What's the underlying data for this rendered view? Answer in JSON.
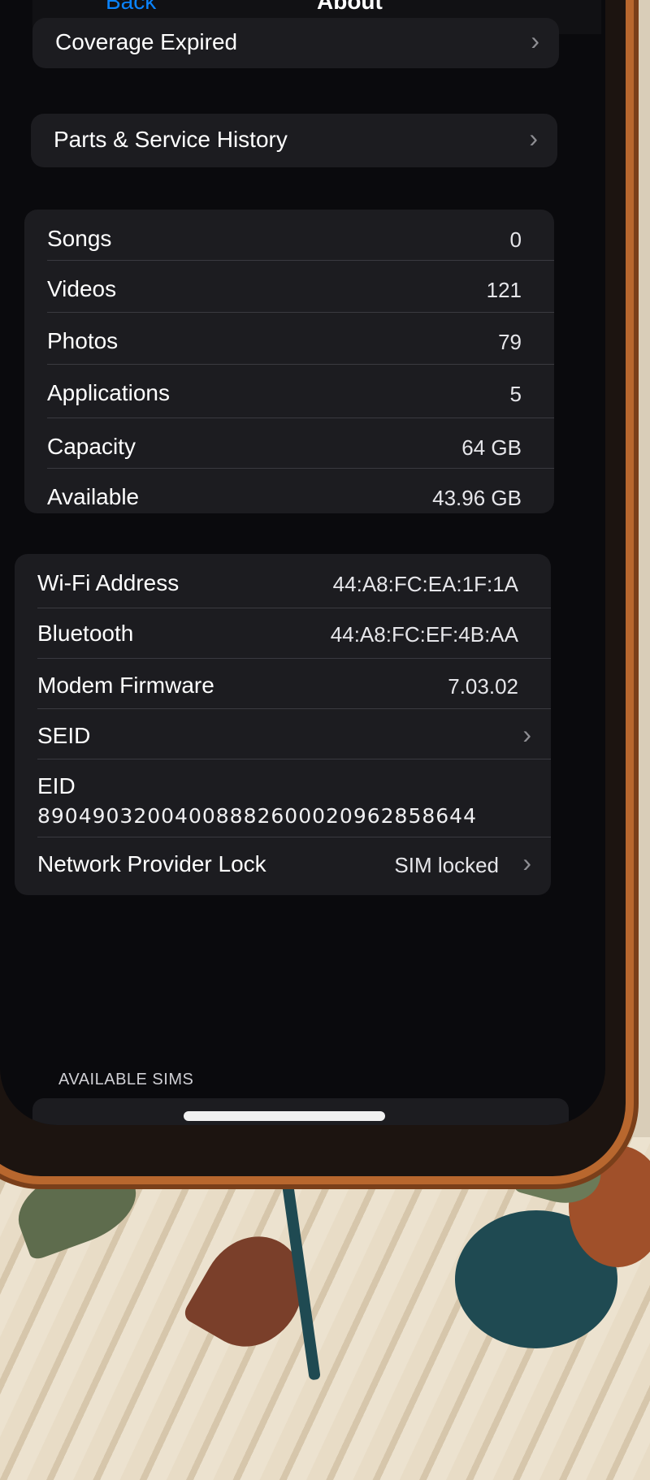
{
  "nav": {
    "back_label": "Back",
    "title": "About"
  },
  "coverage": {
    "label": "Coverage Expired"
  },
  "service": {
    "label": "Parts & Service History"
  },
  "media": {
    "rows": [
      {
        "label": "Songs",
        "value": "0"
      },
      {
        "label": "Videos",
        "value": "121"
      },
      {
        "label": "Photos",
        "value": "79"
      },
      {
        "label": "Applications",
        "value": "5"
      },
      {
        "label": "Capacity",
        "value": "64 GB"
      },
      {
        "label": "Available",
        "value": "43.96 GB"
      }
    ]
  },
  "network": {
    "wifi": {
      "label": "Wi-Fi Address",
      "value": "44:A8:FC:EA:1F:1A"
    },
    "bluetooth": {
      "label": "Bluetooth",
      "value": "44:A8:FC:EF:4B:AA"
    },
    "modem": {
      "label": "Modem Firmware",
      "value": "7.03.02"
    },
    "seid": {
      "label": "SEID"
    },
    "eid": {
      "label": "EID",
      "value": "89049032004008882600020962858644"
    },
    "lock": {
      "label": "Network Provider Lock",
      "value": "SIM locked"
    }
  },
  "sims_header": "AVAILABLE SIMS",
  "icons": {
    "chevron": "chevron-right-icon"
  }
}
